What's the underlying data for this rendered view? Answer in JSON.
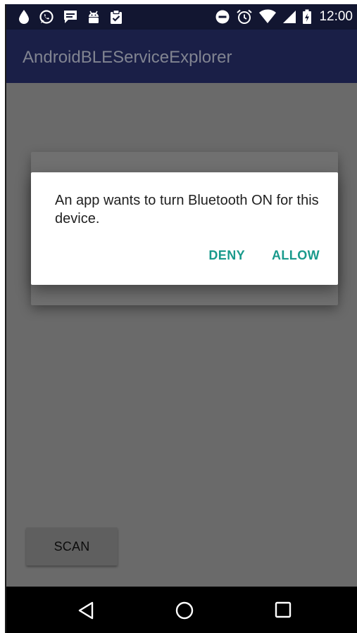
{
  "status_bar": {
    "time": "12:00",
    "left_icons": [
      "water-drop-icon",
      "whatsapp-icon",
      "message-icon",
      "android-icon",
      "clipboard-check-icon"
    ],
    "right_icons": [
      "do-not-disturb-icon",
      "alarm-icon",
      "wifi-icon",
      "signal-icon",
      "battery-charging-icon"
    ]
  },
  "app_bar": {
    "title": "AndroidBLEServiceExplorer"
  },
  "main": {
    "scan_label": "SCAN"
  },
  "dialog": {
    "message": "An app wants to turn Bluetooth ON for this device.",
    "deny_label": "DENY",
    "allow_label": "ALLOW"
  },
  "nav_bar": {
    "icons": [
      "back-icon",
      "home-icon",
      "recents-icon"
    ]
  },
  "colors": {
    "status_bar": "#121631",
    "app_bar_dimmed": "#1a1f47",
    "scrim_background": "#6a6a6a",
    "dialog_accent": "#1a9a8c",
    "nav_bar": "#000000"
  }
}
